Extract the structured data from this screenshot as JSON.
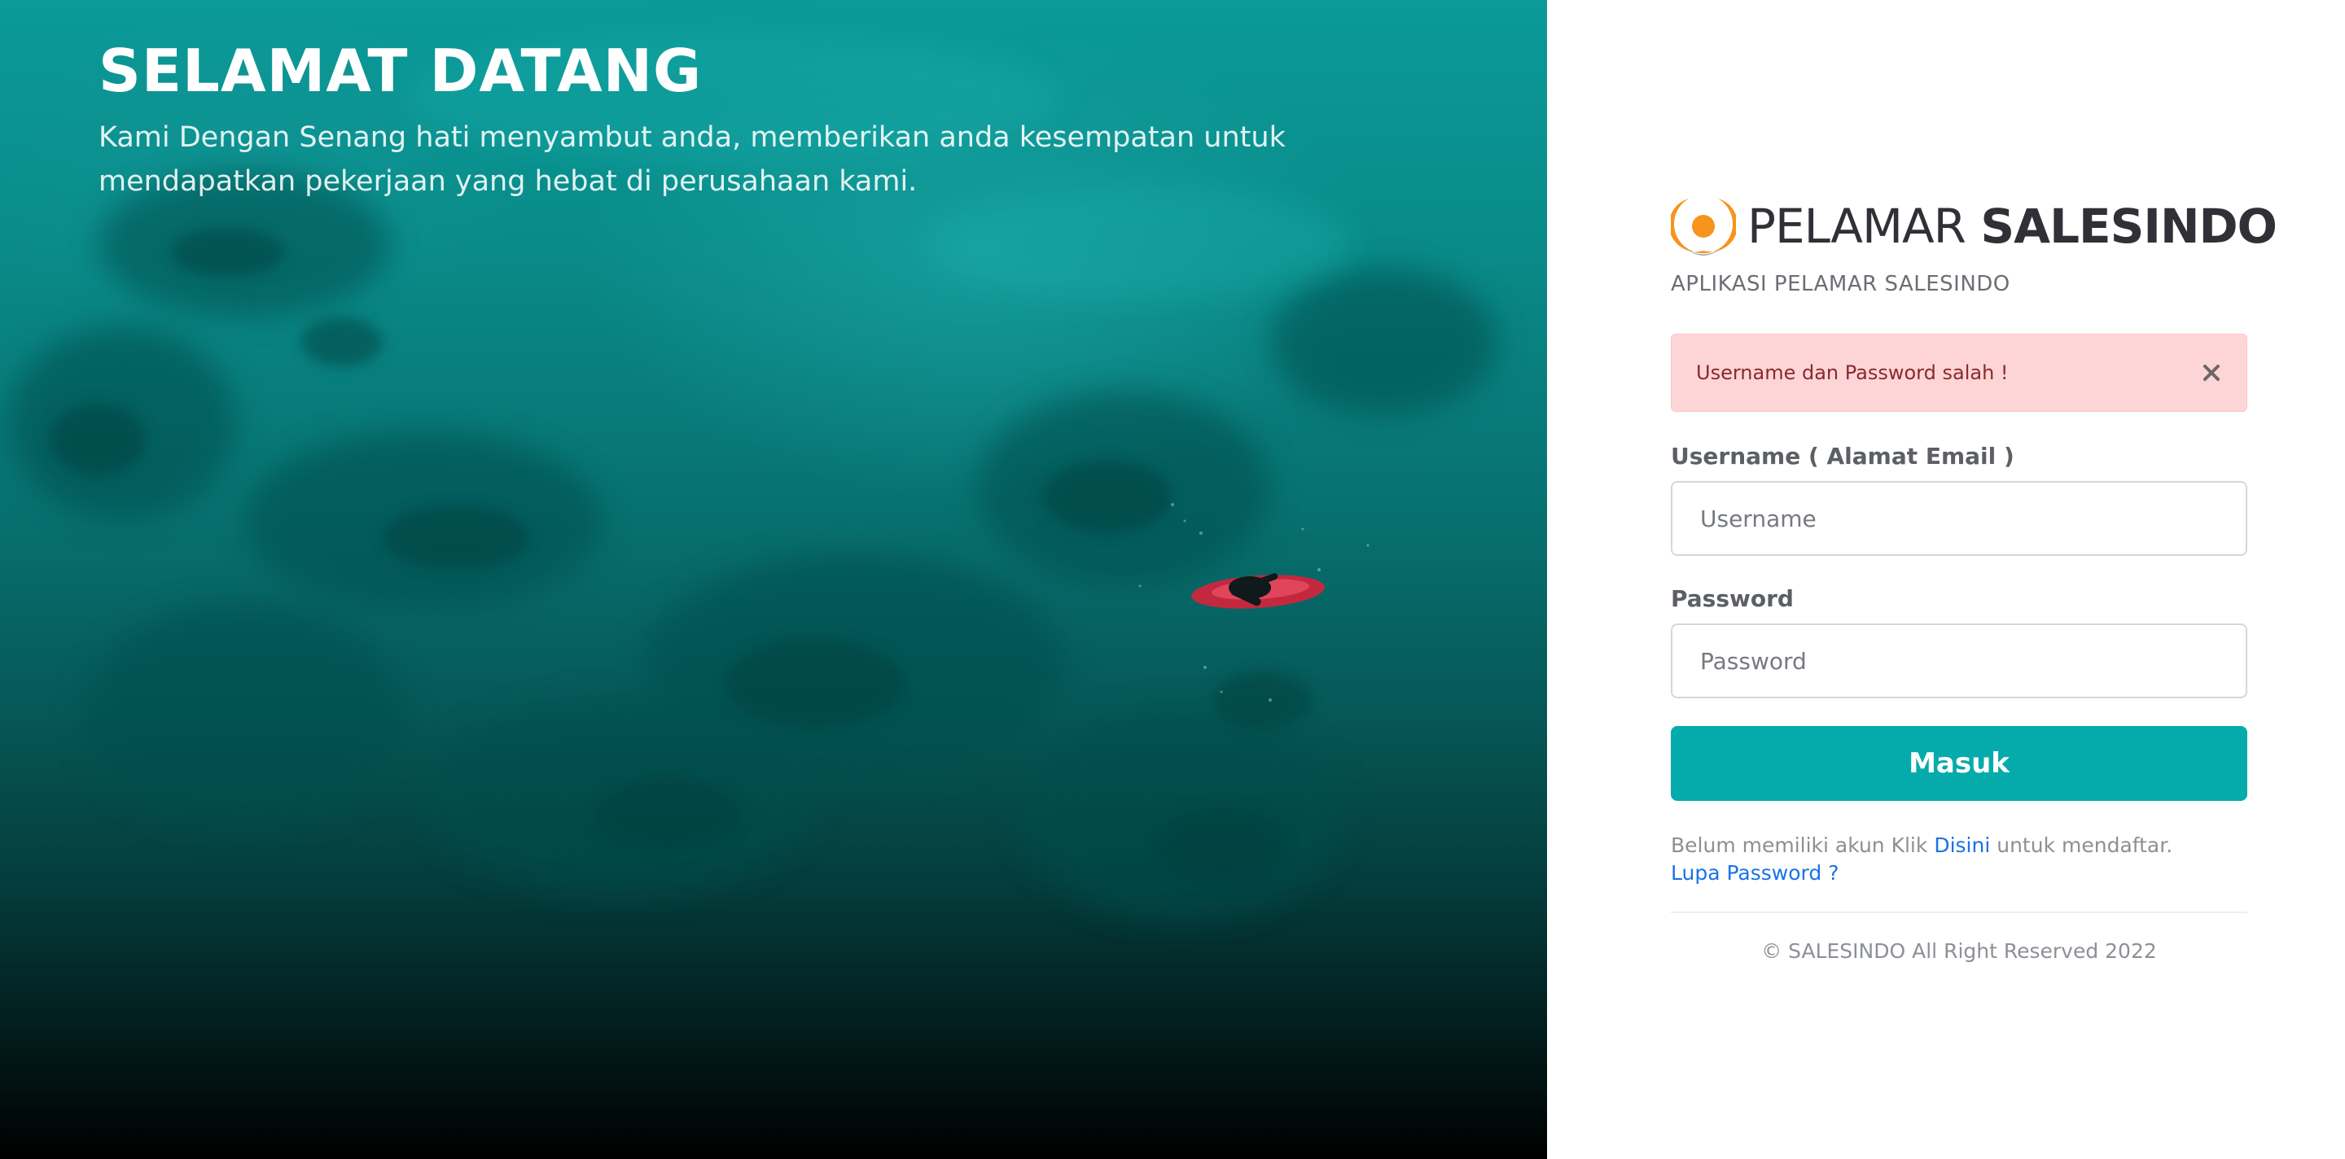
{
  "hero": {
    "title": "SELAMAT DATANG",
    "subtitle": "Kami Dengan Senang hati menyambut anda, memberikan anda kesempatan untuk mendapatkan pekerjaan yang hebat di perusahaan kami."
  },
  "brand": {
    "name_light": "PELAMAR",
    "name_bold": "SALESINDO",
    "subtitle": "APLIKASI PELAMAR SALESINDO",
    "logo_icon": "orange-ring-logo-icon",
    "logo_color": "#f7941d"
  },
  "alert": {
    "message": "Username dan Password salah !",
    "close_icon": "close-icon"
  },
  "form": {
    "username_label": "Username ( Alamat Email )",
    "username_placeholder": "Username",
    "username_value": "",
    "password_label": "Password",
    "password_placeholder": "Password",
    "password_value": "",
    "submit_label": "Masuk"
  },
  "helper": {
    "register_prefix": "Belum memiliki akun Klik",
    "register_link": "Disini",
    "register_suffix": "untuk mendaftar.",
    "forgot_link": "Lupa Password ?"
  },
  "footer": {
    "copyright": "© SALESINDO All Right Reserved 2022"
  },
  "colors": {
    "accent": "#05abab",
    "alert_bg": "#fdd5d6",
    "link": "#1a73e8",
    "hero_water": "#098a88"
  }
}
